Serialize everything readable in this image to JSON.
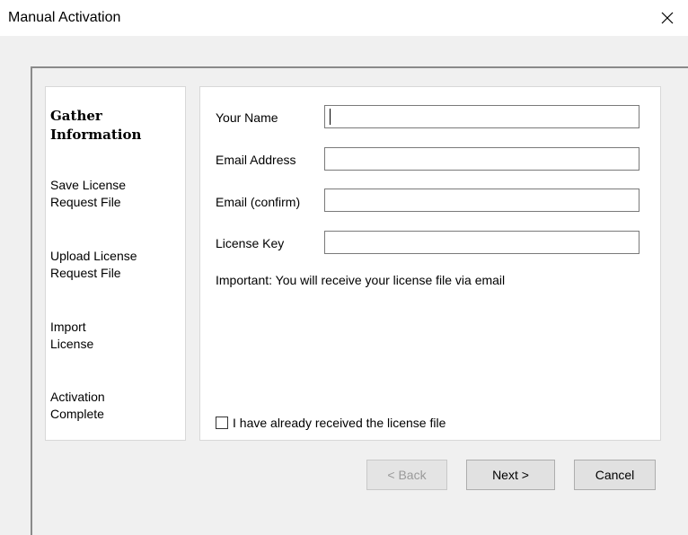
{
  "window": {
    "title": "Manual Activation",
    "close_icon": "close-icon"
  },
  "steps": [
    {
      "label": "Gather\nInformation",
      "active": true
    },
    {
      "label": "Save License\nRequest File",
      "active": false
    },
    {
      "label": "Upload License\nRequest File",
      "active": false
    },
    {
      "label": "Import\nLicense",
      "active": false
    },
    {
      "label": "Activation\nComplete",
      "active": false
    }
  ],
  "form": {
    "name_label": "Your Name",
    "name_value": "",
    "email_label": "Email Address",
    "email_value": "",
    "email_confirm_label": "Email (confirm)",
    "email_confirm_value": "",
    "license_key_label": "License Key",
    "license_key_value": "",
    "note": "Important: You will receive your license file via email",
    "checkbox_label": "I have already received the license file",
    "checkbox_checked": false
  },
  "buttons": {
    "back": "< Back",
    "next": "Next >",
    "cancel": "Cancel"
  }
}
